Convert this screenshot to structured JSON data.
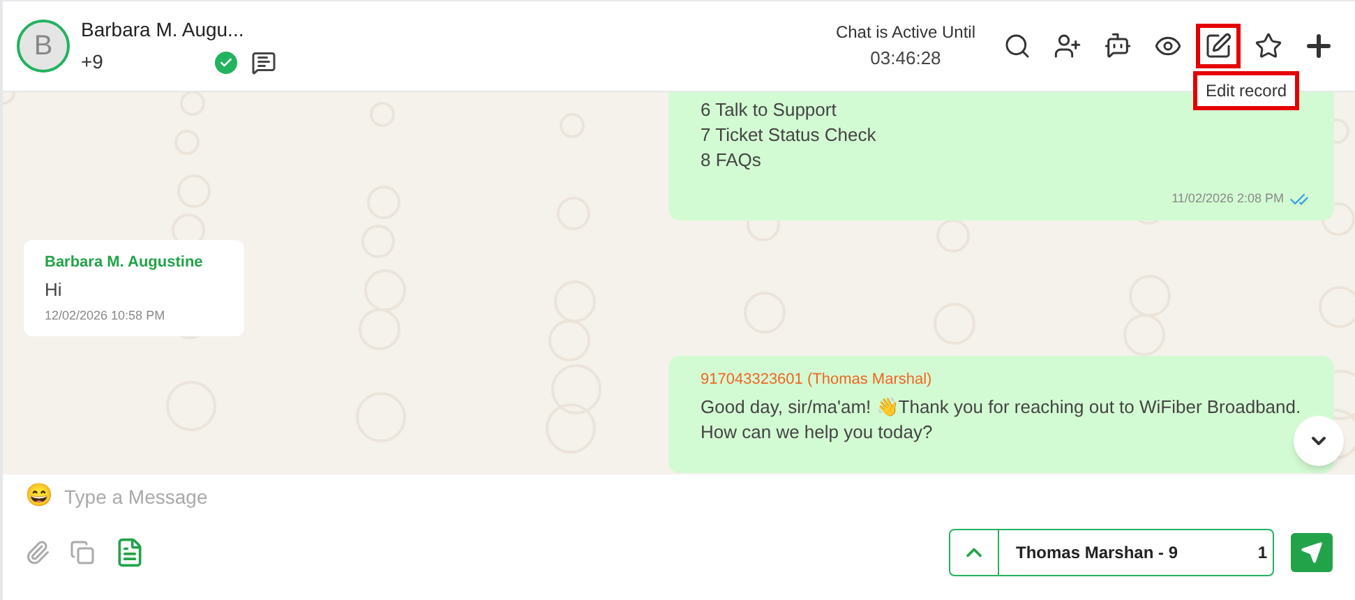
{
  "contact": {
    "initial": "B",
    "name": "Barbara M. Augu...",
    "phone": "+9",
    "verified": true
  },
  "chat_status": {
    "label": "Chat is Active Until",
    "time": "03:46:28"
  },
  "toolbar": [
    {
      "kind": "search",
      "highlighted": false
    },
    {
      "kind": "add-user",
      "highlighted": false
    },
    {
      "kind": "bot",
      "highlighted": false
    },
    {
      "kind": "eye",
      "highlighted": false
    },
    {
      "kind": "edit",
      "highlighted": true,
      "tooltip": "Edit record"
    },
    {
      "kind": "star",
      "highlighted": false
    },
    {
      "kind": "plus",
      "highlighted": false
    }
  ],
  "messages": [
    {
      "kind": "outgoing",
      "lines": [
        "6 Talk to Support",
        "7 Ticket Status Check",
        "8 FAQs"
      ],
      "time": "11/02/2026 2:08 PM",
      "read": true
    },
    {
      "kind": "incoming",
      "sender": "Barbara M. Augustine",
      "lines": [
        "Hi"
      ],
      "time": "12/02/2026 10:58 PM"
    },
    {
      "kind": "outgoing",
      "sender": "917043323601 (Thomas Marshal)",
      "lines": [
        "Good day, sir/ma'am! 👋Thank you for reaching out to WiFiber Broadband.",
        "How can we help you today?"
      ]
    }
  ],
  "composer": {
    "emoji": "😄",
    "placeholder": "Type a Message",
    "agent": "Thomas Marshan - 9",
    "agent_tail": "1"
  }
}
